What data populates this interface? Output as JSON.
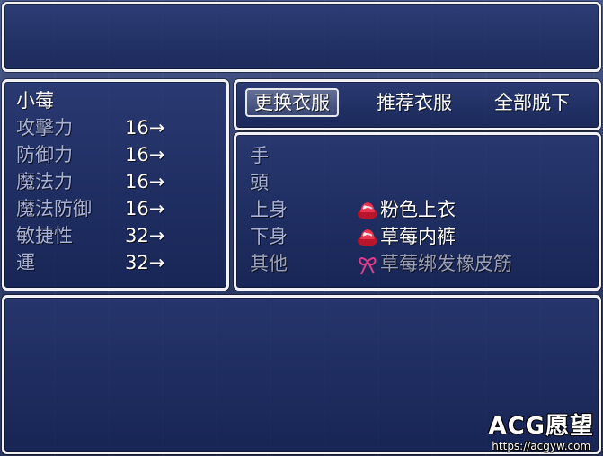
{
  "actor": {
    "name": "小莓"
  },
  "stats": [
    {
      "label": "攻擊力",
      "value": "16→"
    },
    {
      "label": "防御力",
      "value": "16→"
    },
    {
      "label": "魔法力",
      "value": "16→"
    },
    {
      "label": "魔法防御",
      "value": "16→"
    },
    {
      "label": "敏捷性",
      "value": "32→"
    },
    {
      "label": "運",
      "value": "32→"
    }
  ],
  "commands": [
    {
      "label": "更换衣服",
      "selected": true
    },
    {
      "label": "推荐衣服",
      "selected": false
    },
    {
      "label": "全部脱下",
      "selected": false
    }
  ],
  "slots": [
    {
      "label": "手",
      "item": "",
      "icon": ""
    },
    {
      "label": "頭",
      "item": "",
      "icon": ""
    },
    {
      "label": "上身",
      "item": "粉色上衣",
      "icon": "pink-clothing-icon"
    },
    {
      "label": "下身",
      "item": "草莓内裤",
      "icon": "pink-clothing-icon"
    },
    {
      "label": "其他",
      "item": "草莓绑发橡皮筋",
      "icon": "ribbon-icon",
      "disabled": true
    }
  ],
  "watermark": {
    "text": "ACG愿望",
    "url": "https://acgyw.com"
  },
  "colors": {
    "window_bg": "#1e2f70",
    "border": "#f2f2f6",
    "system_text": "#a9b3d9",
    "disabled_text": "#9aa0b8"
  }
}
